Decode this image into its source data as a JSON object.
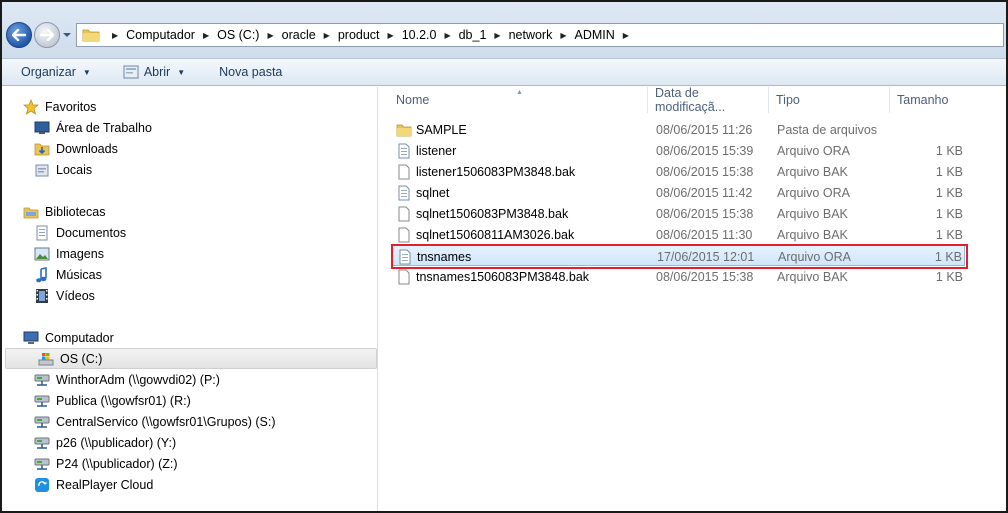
{
  "breadcrumb": [
    "Computador",
    "OS (C:)",
    "oracle",
    "product",
    "10.2.0",
    "db_1",
    "network",
    "ADMIN"
  ],
  "toolbar": {
    "organize_label": "Organizar",
    "open_label": "Abrir",
    "new_folder_label": "Nova pasta"
  },
  "nav": {
    "favorites": {
      "label": "Favoritos",
      "items": [
        "Área de Trabalho",
        "Downloads",
        "Locais"
      ]
    },
    "libraries": {
      "label": "Bibliotecas",
      "items": [
        "Documentos",
        "Imagens",
        "Músicas",
        "Vídeos"
      ]
    },
    "computer": {
      "label": "Computador",
      "items": [
        "OS (C:)",
        "WinthorAdm (\\\\gowvdi02) (P:)",
        "Publica (\\\\gowfsr01) (R:)",
        "CentralServico (\\\\gowfsr01\\Grupos) (S:)",
        "p26 (\\\\publicador) (Y:)",
        "P24 (\\\\publicador) (Z:)",
        "RealPlayer Cloud"
      ]
    }
  },
  "columns": {
    "name": "Nome",
    "date": "Data de modificaçã...",
    "type": "Tipo",
    "size": "Tamanho"
  },
  "files": [
    {
      "name": "SAMPLE",
      "date": "08/06/2015 11:26",
      "type": "Pasta de arquivos",
      "size": ""
    },
    {
      "name": "listener",
      "date": "08/06/2015 15:39",
      "type": "Arquivo ORA",
      "size": "1 KB"
    },
    {
      "name": "listener1506083PM3848.bak",
      "date": "08/06/2015 15:38",
      "type": "Arquivo BAK",
      "size": "1 KB"
    },
    {
      "name": "sqlnet",
      "date": "08/06/2015 11:42",
      "type": "Arquivo ORA",
      "size": "1 KB"
    },
    {
      "name": "sqlnet1506083PM3848.bak",
      "date": "08/06/2015 15:38",
      "type": "Arquivo BAK",
      "size": "1 KB"
    },
    {
      "name": "sqlnet15060811AM3026.bak",
      "date": "08/06/2015 11:30",
      "type": "Arquivo BAK",
      "size": "1 KB"
    },
    {
      "name": "tnsnames",
      "date": "17/06/2015 12:01",
      "type": "Arquivo ORA",
      "size": "1 KB"
    },
    {
      "name": "tnsnames1506083PM3848.bak",
      "date": "08/06/2015 15:38",
      "type": "Arquivo BAK",
      "size": "1 KB"
    }
  ],
  "colors": {
    "selection_outline": "#e0202a",
    "selection_fill": "#cfe6fb",
    "toolbar_text": "#1e395b"
  }
}
